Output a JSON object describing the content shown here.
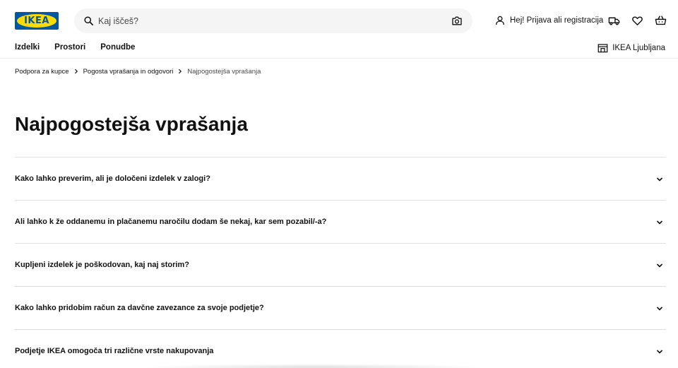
{
  "header": {
    "logo_text": "IKEA",
    "search": {
      "placeholder": "Kaj iščeš?",
      "value": ""
    },
    "account_label": "Hej! Prijava ali registracija",
    "icons": [
      "search-icon",
      "camera-icon",
      "user-icon",
      "delivery-truck-icon",
      "heart-icon",
      "shopping-basket-icon"
    ],
    "colors": {
      "logo_blue": "#0058a3",
      "logo_yellow": "#ffdb00"
    }
  },
  "nav": {
    "items": [
      {
        "label": "Izdelki"
      },
      {
        "label": "Prostori"
      },
      {
        "label": "Ponudbe"
      }
    ],
    "store_label": "IKEA Ljubljana"
  },
  "breadcrumb": [
    {
      "label": "Podpora za kupce"
    },
    {
      "label": "Pogosta vprašanja in odgovori"
    },
    {
      "label": "Najpogostejša vprašanja"
    }
  ],
  "page": {
    "title": "Najpogostejša vprašanja"
  },
  "faq": [
    {
      "question": "Kako lahko preverim, ali je določeni izdelek v zalogi?"
    },
    {
      "question": "Ali lahko k že oddanemu in plačanemu naročilu dodam še nekaj, kar sem pozabil/-a?"
    },
    {
      "question": "Kupljeni izdelek je poškodovan, kaj naj storim?"
    },
    {
      "question": "Kako lahko pridobim račun za davčne zavezance za svoje podjetje?"
    },
    {
      "question": "Podjetje IKEA omogoča tri različne vrste nakupovanja"
    }
  ]
}
